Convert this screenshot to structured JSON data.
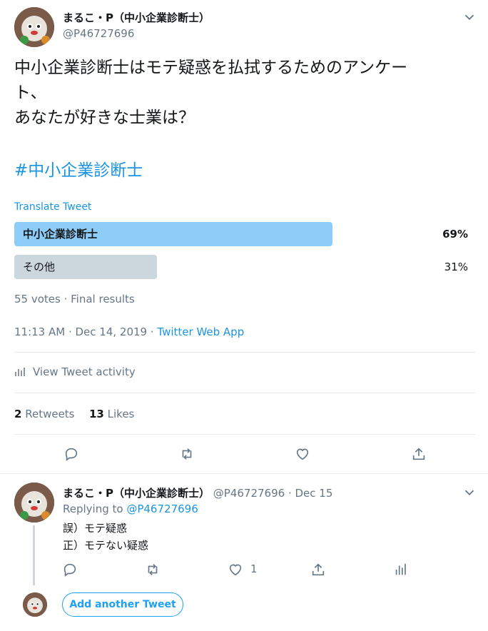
{
  "tweet": {
    "author_name": "まるこ・P（中小企業診断士）",
    "author_handle": "@P46727696",
    "text_line1": "中小企業診断士はモテ疑惑を払拭するためのアンケー",
    "text_line2": "ト、",
    "text_line3": "あなたが好きな士業は？",
    "hashtag": "#中小企業診断士",
    "translate_label": "Translate Tweet",
    "poll": {
      "options": [
        {
          "label": "中小企業診断士",
          "percent_text": "69%",
          "percent": 69,
          "winner": true
        },
        {
          "label": "その他",
          "percent_text": "31%",
          "percent": 31,
          "winner": false
        }
      ],
      "summary": "55 votes · Final results"
    },
    "timestamp": "11:13 AM · Dec 14, 2019 · ",
    "source": "Twitter Web App",
    "activity_label": "View Tweet activity",
    "retweets_count": "2",
    "retweets_label": "Retweets",
    "likes_count": "13",
    "likes_label": "Likes"
  },
  "reply": {
    "author_name": "まるこ・P（中小企業診断士）",
    "author_handle": "@P46727696",
    "date": " · Dec 15",
    "replying_prefix": "Replying to ",
    "replying_handle": "@P46727696",
    "line1": "誤）モテ疑惑",
    "line2": "正）モテない疑惑",
    "like_count": "1"
  },
  "composer": {
    "add_button_label": "Add another Tweet"
  },
  "colors": {
    "accent": "#1da1f2",
    "winner_bar": "#8ecdf8",
    "loser_bar": "#ccd6dd",
    "muted": "#657786"
  }
}
